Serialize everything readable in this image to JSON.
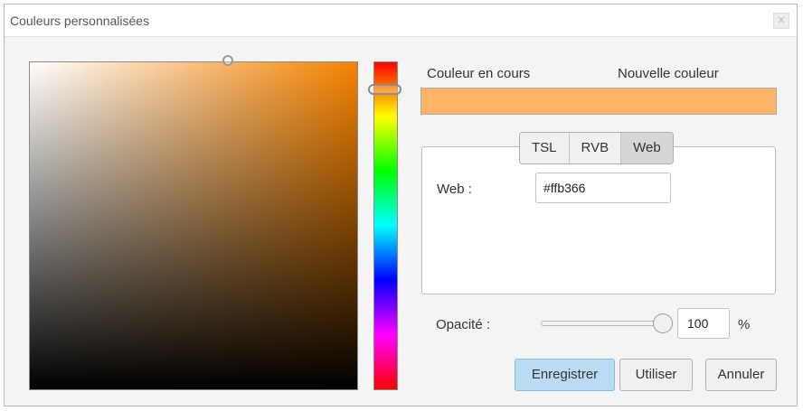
{
  "window": {
    "title": "Couleurs personnalisées",
    "close_icon": "close-icon"
  },
  "picker": {
    "hue_color": "#f58300"
  },
  "labels": {
    "current_color": "Couleur en cours",
    "new_color": "Nouvelle couleur"
  },
  "swatches": {
    "current": "#ffb366",
    "new": "#ffb366"
  },
  "tabs": [
    {
      "label": "TSL"
    },
    {
      "label": "RVB"
    },
    {
      "label": "Web"
    }
  ],
  "selected_tab": "Web",
  "web": {
    "label": "Web :",
    "value": "#ffb366"
  },
  "opacity": {
    "label": "Opacité :",
    "value": "100",
    "unit": "%",
    "slider_level": 1.0
  },
  "buttons": {
    "save": "Enregistrer",
    "use": "Utiliser",
    "cancel": "Annuler"
  }
}
